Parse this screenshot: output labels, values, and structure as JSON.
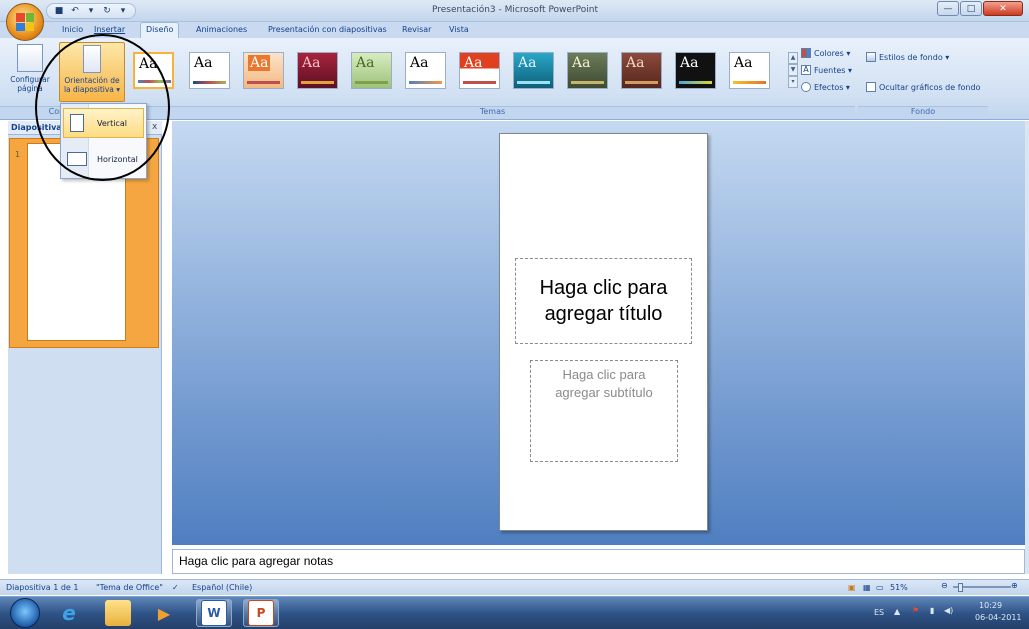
{
  "window": {
    "title": "Presentación3 - Microsoft PowerPoint"
  },
  "tabs": [
    "Inicio",
    "Insertar",
    "Diseño",
    "Animaciones",
    "Presentación con diapositivas",
    "Revisar",
    "Vista"
  ],
  "ribbon": {
    "page_setup": {
      "label_line1": "Configurar",
      "label_line2": "página",
      "group_label": "Configu"
    },
    "orientation": {
      "label_line1": "Orientación de",
      "label_line2": "la diapositiva ▾"
    },
    "themes": {
      "group_label": "Temas",
      "sample_text": "Aa",
      "colors": "Colores ▾",
      "fonts": "Fuentes ▾",
      "effects": "Efectos ▾"
    },
    "background": {
      "styles": "Estilos de fondo ▾",
      "hide_graphics": "Ocultar gráficos de fondo",
      "group_label": "Fondo"
    }
  },
  "dropdown": {
    "vertical": "Vertical",
    "horizontal": "Horizontal"
  },
  "left_pane": {
    "tab": "Diapositiva",
    "close": "x",
    "slide_number": "1"
  },
  "slide": {
    "title_placeholder_1": "Haga clic para",
    "title_placeholder_2": "agregar título",
    "subtitle_placeholder_1": "Haga clic para",
    "subtitle_placeholder_2": "agregar subtítulo"
  },
  "notes": {
    "placeholder": "Haga clic para agregar notas"
  },
  "status": {
    "slide_info": "Diapositiva 1 de 1",
    "theme": "\"Tema de Office\"",
    "language": "Español (Chile)",
    "zoom": "51%"
  },
  "taskbar": {
    "lang": "ES",
    "time": "10:29",
    "date": "06-04-2011"
  }
}
